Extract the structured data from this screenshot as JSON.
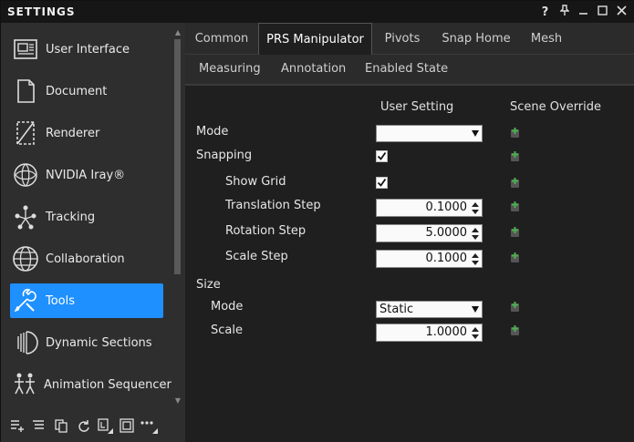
{
  "window": {
    "title": "SETTINGS",
    "controls": [
      "?",
      "📌",
      "—",
      "☐",
      "✕"
    ]
  },
  "sidebar": {
    "items": [
      {
        "label": "User Interface",
        "icon": "user-interface-icon"
      },
      {
        "label": "Document",
        "icon": "document-icon"
      },
      {
        "label": "Renderer",
        "icon": "renderer-icon"
      },
      {
        "label": "NVIDIA Iray®",
        "icon": "nvidia-iray-icon"
      },
      {
        "label": "Tracking",
        "icon": "tracking-icon"
      },
      {
        "label": "Collaboration",
        "icon": "collaboration-icon"
      },
      {
        "label": "Tools",
        "icon": "tools-icon",
        "active": true
      },
      {
        "label": "Dynamic Sections",
        "icon": "dynamic-sections-icon"
      },
      {
        "label": "Animation Sequencer",
        "icon": "animation-sequencer-icon"
      }
    ],
    "bottom_icons": [
      "add-list-icon",
      "list-icon",
      "copy-icon",
      "refresh-icon",
      "frame-icon",
      "fit-icon",
      "more-icon"
    ]
  },
  "tabs_row1": [
    "Common",
    "PRS Manipulator",
    "Pivots",
    "Snap Home",
    "Mesh"
  ],
  "tabs_row2": [
    "Measuring",
    "Annotation",
    "Enabled State"
  ],
  "active_tab": "PRS Manipulator",
  "columns": {
    "user_setting": "User Setting",
    "scene_override": "Scene Override"
  },
  "settings": {
    "mode_label": "Mode",
    "mode_value": "",
    "snapping_label": "Snapping",
    "snapping_checked": true,
    "show_grid_label": "Show Grid",
    "show_grid_checked": true,
    "translation_step_label": "Translation Step",
    "translation_step_value": "0.1000",
    "rotation_step_label": "Rotation Step",
    "rotation_step_value": "5.0000",
    "scale_step_label": "Scale Step",
    "scale_step_value": "0.1000",
    "size_label": "Size",
    "size_mode_label": "Mode",
    "size_mode_value": "Static",
    "size_scale_label": "Scale",
    "size_scale_value": "1.0000"
  },
  "colors": {
    "accent": "#1e90ff",
    "override_icon": "#4caf50"
  }
}
